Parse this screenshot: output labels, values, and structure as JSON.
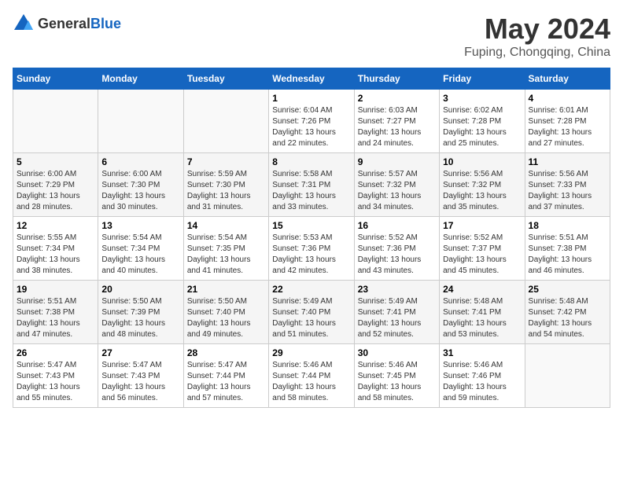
{
  "header": {
    "logo_general": "General",
    "logo_blue": "Blue",
    "month_title": "May 2024",
    "location": "Fuping, Chongqing, China"
  },
  "calendar": {
    "days_of_week": [
      "Sunday",
      "Monday",
      "Tuesday",
      "Wednesday",
      "Thursday",
      "Friday",
      "Saturday"
    ],
    "weeks": [
      [
        {
          "day": "",
          "info": ""
        },
        {
          "day": "",
          "info": ""
        },
        {
          "day": "",
          "info": ""
        },
        {
          "day": "1",
          "info": "Sunrise: 6:04 AM\nSunset: 7:26 PM\nDaylight: 13 hours\nand 22 minutes."
        },
        {
          "day": "2",
          "info": "Sunrise: 6:03 AM\nSunset: 7:27 PM\nDaylight: 13 hours\nand 24 minutes."
        },
        {
          "day": "3",
          "info": "Sunrise: 6:02 AM\nSunset: 7:28 PM\nDaylight: 13 hours\nand 25 minutes."
        },
        {
          "day": "4",
          "info": "Sunrise: 6:01 AM\nSunset: 7:28 PM\nDaylight: 13 hours\nand 27 minutes."
        }
      ],
      [
        {
          "day": "5",
          "info": "Sunrise: 6:00 AM\nSunset: 7:29 PM\nDaylight: 13 hours\nand 28 minutes."
        },
        {
          "day": "6",
          "info": "Sunrise: 6:00 AM\nSunset: 7:30 PM\nDaylight: 13 hours\nand 30 minutes."
        },
        {
          "day": "7",
          "info": "Sunrise: 5:59 AM\nSunset: 7:30 PM\nDaylight: 13 hours\nand 31 minutes."
        },
        {
          "day": "8",
          "info": "Sunrise: 5:58 AM\nSunset: 7:31 PM\nDaylight: 13 hours\nand 33 minutes."
        },
        {
          "day": "9",
          "info": "Sunrise: 5:57 AM\nSunset: 7:32 PM\nDaylight: 13 hours\nand 34 minutes."
        },
        {
          "day": "10",
          "info": "Sunrise: 5:56 AM\nSunset: 7:32 PM\nDaylight: 13 hours\nand 35 minutes."
        },
        {
          "day": "11",
          "info": "Sunrise: 5:56 AM\nSunset: 7:33 PM\nDaylight: 13 hours\nand 37 minutes."
        }
      ],
      [
        {
          "day": "12",
          "info": "Sunrise: 5:55 AM\nSunset: 7:34 PM\nDaylight: 13 hours\nand 38 minutes."
        },
        {
          "day": "13",
          "info": "Sunrise: 5:54 AM\nSunset: 7:34 PM\nDaylight: 13 hours\nand 40 minutes."
        },
        {
          "day": "14",
          "info": "Sunrise: 5:54 AM\nSunset: 7:35 PM\nDaylight: 13 hours\nand 41 minutes."
        },
        {
          "day": "15",
          "info": "Sunrise: 5:53 AM\nSunset: 7:36 PM\nDaylight: 13 hours\nand 42 minutes."
        },
        {
          "day": "16",
          "info": "Sunrise: 5:52 AM\nSunset: 7:36 PM\nDaylight: 13 hours\nand 43 minutes."
        },
        {
          "day": "17",
          "info": "Sunrise: 5:52 AM\nSunset: 7:37 PM\nDaylight: 13 hours\nand 45 minutes."
        },
        {
          "day": "18",
          "info": "Sunrise: 5:51 AM\nSunset: 7:38 PM\nDaylight: 13 hours\nand 46 minutes."
        }
      ],
      [
        {
          "day": "19",
          "info": "Sunrise: 5:51 AM\nSunset: 7:38 PM\nDaylight: 13 hours\nand 47 minutes."
        },
        {
          "day": "20",
          "info": "Sunrise: 5:50 AM\nSunset: 7:39 PM\nDaylight: 13 hours\nand 48 minutes."
        },
        {
          "day": "21",
          "info": "Sunrise: 5:50 AM\nSunset: 7:40 PM\nDaylight: 13 hours\nand 49 minutes."
        },
        {
          "day": "22",
          "info": "Sunrise: 5:49 AM\nSunset: 7:40 PM\nDaylight: 13 hours\nand 51 minutes."
        },
        {
          "day": "23",
          "info": "Sunrise: 5:49 AM\nSunset: 7:41 PM\nDaylight: 13 hours\nand 52 minutes."
        },
        {
          "day": "24",
          "info": "Sunrise: 5:48 AM\nSunset: 7:41 PM\nDaylight: 13 hours\nand 53 minutes."
        },
        {
          "day": "25",
          "info": "Sunrise: 5:48 AM\nSunset: 7:42 PM\nDaylight: 13 hours\nand 54 minutes."
        }
      ],
      [
        {
          "day": "26",
          "info": "Sunrise: 5:47 AM\nSunset: 7:43 PM\nDaylight: 13 hours\nand 55 minutes."
        },
        {
          "day": "27",
          "info": "Sunrise: 5:47 AM\nSunset: 7:43 PM\nDaylight: 13 hours\nand 56 minutes."
        },
        {
          "day": "28",
          "info": "Sunrise: 5:47 AM\nSunset: 7:44 PM\nDaylight: 13 hours\nand 57 minutes."
        },
        {
          "day": "29",
          "info": "Sunrise: 5:46 AM\nSunset: 7:44 PM\nDaylight: 13 hours\nand 58 minutes."
        },
        {
          "day": "30",
          "info": "Sunrise: 5:46 AM\nSunset: 7:45 PM\nDaylight: 13 hours\nand 58 minutes."
        },
        {
          "day": "31",
          "info": "Sunrise: 5:46 AM\nSunset: 7:46 PM\nDaylight: 13 hours\nand 59 minutes."
        },
        {
          "day": "",
          "info": ""
        }
      ]
    ]
  }
}
